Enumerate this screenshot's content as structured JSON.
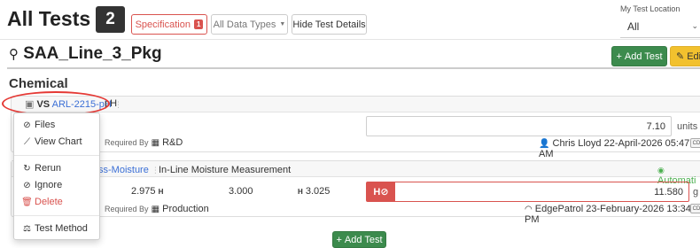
{
  "header": {
    "title": "All Tests",
    "count": "2",
    "specification_label": "Specification",
    "specification_badge": "1",
    "data_types_label": "All Data Types",
    "hide_details_label": "Hide Test Details",
    "location_label": "My Test Location",
    "location_value": "All"
  },
  "sample": {
    "name": "SAA_Line_3_Pkg",
    "add_test_label": "Add Test",
    "edit_label": "Edit"
  },
  "section_title": "Chemical",
  "tests": [
    {
      "vs_label": "VS",
      "test_code": "ARL-2215-pH",
      "name": "pH",
      "result": "7.10",
      "units": "units",
      "required_by_label": "Required By",
      "required_by": "R&D",
      "entered_by": "Chris Lloyd 22-April-2026 05:47 AM",
      "status_chip": "CD"
    },
    {
      "test_code": "ss-Moisture",
      "name": "In-Line Moisture Measurement",
      "automation_label": "Automati",
      "spec_low": "2.975",
      "spec_target": "3.000",
      "spec_high": "3.025",
      "result": "11.580",
      "units": "g",
      "required_by_label": "Required By",
      "required_by": "Production",
      "entered_by": "EdgePatrol 23-February-2026 13:34 PM",
      "status_chip": "CD"
    }
  ],
  "context_menu": {
    "items": [
      {
        "label": "Files",
        "icon": "paperclip-icon"
      },
      {
        "label": "View Chart",
        "icon": "line-chart-icon"
      },
      {
        "label": "Rerun",
        "icon": "refresh-icon"
      },
      {
        "label": "Ignore",
        "icon": "ban-icon"
      },
      {
        "label": "Delete",
        "icon": "trash-icon"
      },
      {
        "label": "Test Method",
        "icon": "balance-scale-icon"
      }
    ]
  },
  "footer": {
    "add_test_label": "Add Test"
  },
  "colors": {
    "accent_green": "#3c8b4d",
    "danger_red": "#d9534f",
    "edit_yellow": "#f2c12e",
    "link_blue": "#3b6fd6"
  }
}
